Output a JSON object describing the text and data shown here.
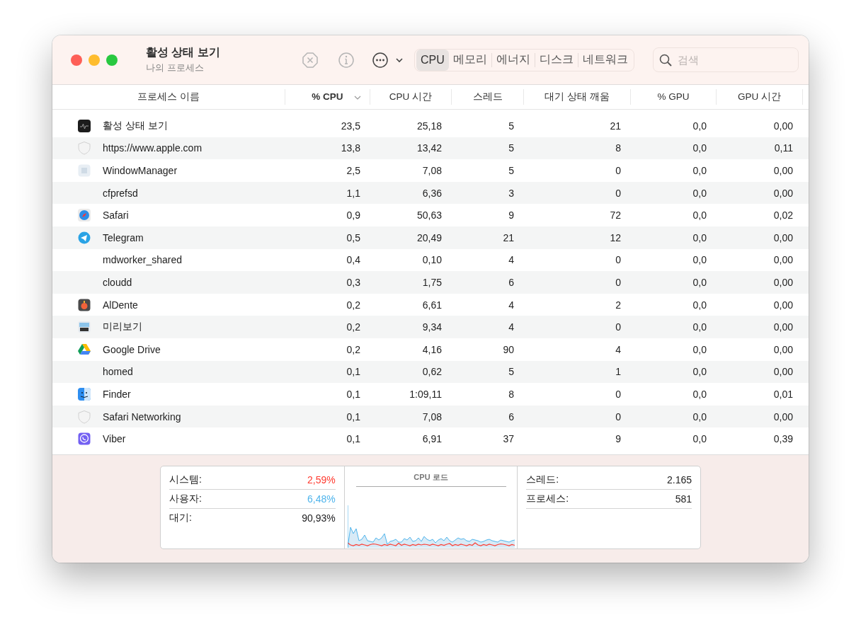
{
  "window": {
    "title": "활성 상태 보기",
    "subtitle": "나의 프로세스"
  },
  "tabs": [
    {
      "label": "CPU",
      "selected": true
    },
    {
      "label": "메모리",
      "selected": false
    },
    {
      "label": "에너지",
      "selected": false
    },
    {
      "label": "디스크",
      "selected": false
    },
    {
      "label": "네트워크",
      "selected": false
    }
  ],
  "search": {
    "placeholder": "검색"
  },
  "table": {
    "columns": [
      {
        "label": "프로세스 이름",
        "selected": false
      },
      {
        "label": "% CPU",
        "selected": true
      },
      {
        "label": "CPU 시간",
        "selected": false
      },
      {
        "label": "스레드",
        "selected": false
      },
      {
        "label": "대기 상태 깨움",
        "selected": false
      },
      {
        "label": "% GPU",
        "selected": false
      },
      {
        "label": "GPU 시간",
        "selected": false
      }
    ],
    "rows": [
      {
        "kind": "monitor",
        "cells": [
          "활성 상태 보기",
          "23,5",
          "25,18",
          "5",
          "21",
          "0,0",
          "0,00"
        ]
      },
      {
        "kind": "shield",
        "cells": [
          "https://www.apple.com",
          "13,8",
          "13,42",
          "5",
          "8",
          "0,0",
          "0,11"
        ]
      },
      {
        "kind": "grid",
        "cells": [
          "WindowManager",
          "2,5",
          "7,08",
          "5",
          "0",
          "0,0",
          "0,00"
        ]
      },
      {
        "kind": "none",
        "cells": [
          "cfprefsd",
          "1,1",
          "6,36",
          "3",
          "0",
          "0,0",
          "0,00"
        ]
      },
      {
        "kind": "compass",
        "cells": [
          "Safari",
          "0,9",
          "50,63",
          "9",
          "72",
          "0,0",
          "0,02"
        ]
      },
      {
        "kind": "plane",
        "cells": [
          "Telegram",
          "0,5",
          "20,49",
          "21",
          "12",
          "0,0",
          "0,00"
        ]
      },
      {
        "kind": "none",
        "cells": [
          "mdworker_shared",
          "0,4",
          "0,10",
          "4",
          "0",
          "0,0",
          "0,00"
        ]
      },
      {
        "kind": "none",
        "cells": [
          "cloudd",
          "0,3",
          "1,75",
          "6",
          "0",
          "0,0",
          "0,00"
        ]
      },
      {
        "kind": "pot",
        "cells": [
          "AlDente",
          "0,2",
          "6,61",
          "4",
          "2",
          "0,0",
          "0,00"
        ]
      },
      {
        "kind": "photo",
        "cells": [
          "미리보기",
          "0,2",
          "9,34",
          "4",
          "0",
          "0,0",
          "0,00"
        ]
      },
      {
        "kind": "triangle",
        "cells": [
          "Google Drive",
          "0,2",
          "4,16",
          "90",
          "4",
          "0,0",
          "0,00"
        ]
      },
      {
        "kind": "none",
        "cells": [
          "homed",
          "0,1",
          "0,62",
          "5",
          "1",
          "0,0",
          "0,00"
        ]
      },
      {
        "kind": "face",
        "cells": [
          "Finder",
          "0,1",
          "1:09,11",
          "8",
          "0",
          "0,0",
          "0,01"
        ]
      },
      {
        "kind": "shield",
        "cells": [
          "Safari Networking",
          "0,1",
          "7,08",
          "6",
          "0",
          "0,0",
          "0,00"
        ]
      },
      {
        "kind": "phone",
        "cells": [
          "Viber",
          "0,1",
          "6,91",
          "37",
          "9",
          "0,0",
          "0,39"
        ]
      }
    ]
  },
  "summary": {
    "load_stats": [
      {
        "label": "시스템:",
        "value": "2,59%",
        "color": "#ff3b30"
      },
      {
        "label": "사용자:",
        "value": "6,48%",
        "color": "#4fb4ec"
      },
      {
        "label": "대기:",
        "value": "90,93%",
        "color": "#1d1d1f"
      }
    ],
    "chart_title": "CPU 로드",
    "counts": [
      {
        "label": "스레드:",
        "value": "2.165"
      },
      {
        "label": "프로세스:",
        "value": "581"
      }
    ]
  }
}
